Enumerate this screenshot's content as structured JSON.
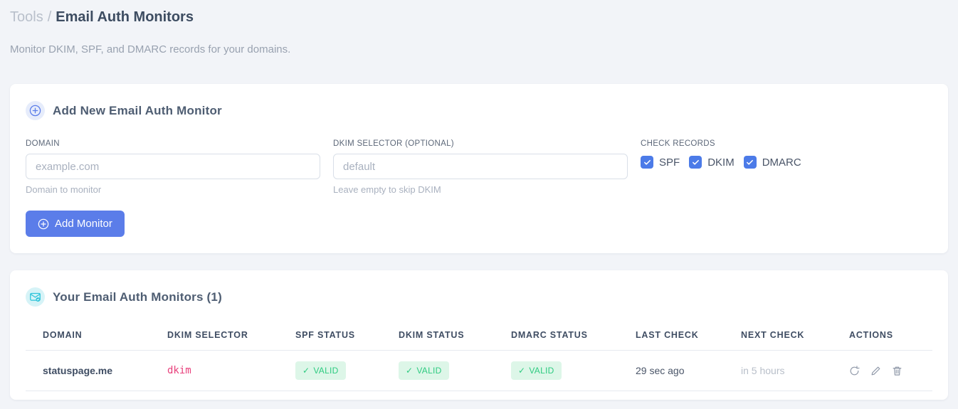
{
  "colors": {
    "accent_blue": "#5b7de9",
    "checkbox_blue": "#4c7be8",
    "icon_cyan": "#2bc3d9",
    "badge_green_bg": "#ddf6e8",
    "badge_green_text": "#2ecb81",
    "selector_pink": "#e8417c"
  },
  "breadcrumb": {
    "parent": "Tools",
    "separator": "/",
    "current": "Email Auth Monitors"
  },
  "subtitle": "Monitor DKIM, SPF, and DMARC records for your domains.",
  "add_form": {
    "title": "Add New Email Auth Monitor",
    "header_icon": "plus-circle-icon",
    "domain_field": {
      "label": "DOMAIN",
      "value": "",
      "placeholder": "example.com",
      "help": "Domain to monitor"
    },
    "dkim_field": {
      "label": "DKIM SELECTOR (OPTIONAL)",
      "value": "",
      "placeholder": "default",
      "help": "Leave empty to skip DKIM"
    },
    "check_records": {
      "label": "CHECK RECORDS",
      "options": [
        {
          "label": "SPF",
          "checked": true
        },
        {
          "label": "DKIM",
          "checked": true
        },
        {
          "label": "DMARC",
          "checked": true
        }
      ]
    },
    "submit_label": "Add Monitor"
  },
  "monitors": {
    "title": "Your Email Auth Monitors (1)",
    "count": 1,
    "header_icon": "envelope-check-icon",
    "valid_check_glyph": "✓",
    "columns": {
      "domain": "DOMAIN",
      "dkim_selector": "DKIM SELECTOR",
      "spf_status": "SPF STATUS",
      "dkim_status": "DKIM STATUS",
      "dmarc_status": "DMARC STATUS",
      "last_check": "LAST CHECK",
      "next_check": "NEXT CHECK",
      "actions": "ACTIONS"
    },
    "rows": [
      {
        "domain": "statuspage.me",
        "dkim_selector": "dkim",
        "spf_status": "VALID",
        "dkim_status": "VALID",
        "dmarc_status": "VALID",
        "last_check": "29 sec ago",
        "next_check": "in 5 hours",
        "action_icons": [
          "refresh-icon",
          "edit-icon",
          "delete-icon"
        ]
      }
    ]
  }
}
